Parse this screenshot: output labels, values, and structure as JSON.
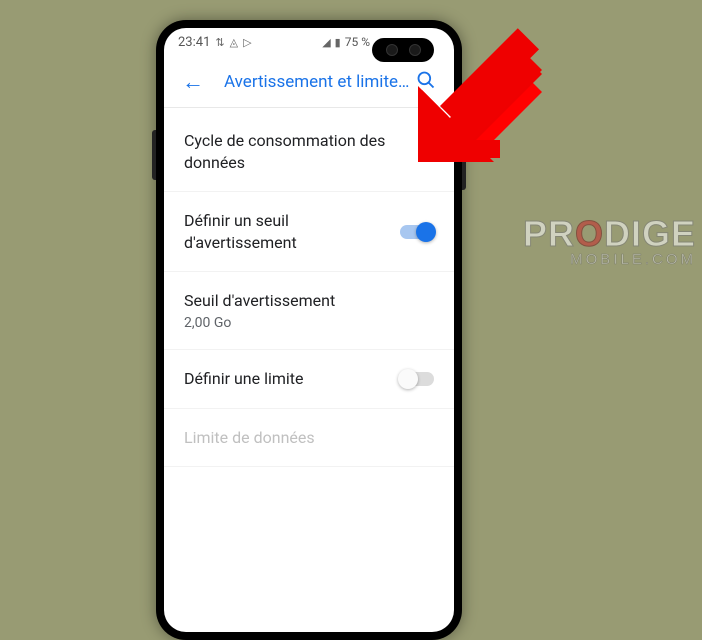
{
  "status": {
    "time": "23:41",
    "battery": "75 %"
  },
  "appbar": {
    "title": "Avertissement et limite pour l…"
  },
  "settings": {
    "cycle": {
      "title": "Cycle de consommation des données"
    },
    "warning_toggle": {
      "title": "Définir un seuil d'avertissement",
      "on": true
    },
    "threshold": {
      "title": "Seuil d'avertissement",
      "value": "2,00 Go"
    },
    "limit_toggle": {
      "title": "Définir une limite",
      "on": false
    },
    "limit": {
      "title": "Limite de données"
    }
  },
  "watermark": {
    "brand_pre": "PR",
    "brand_accent": "O",
    "brand_post": "DIGE",
    "sub": "MOBILE.COM"
  }
}
